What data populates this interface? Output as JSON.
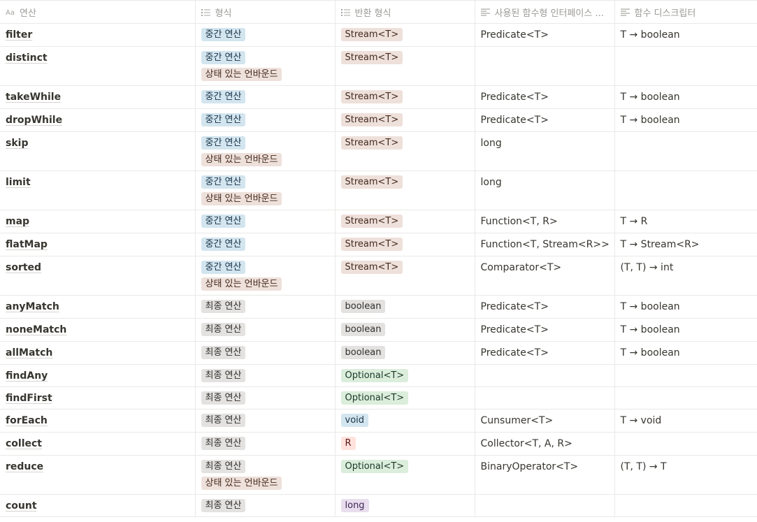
{
  "headers": [
    {
      "label": "연산",
      "icon": "title-aa-icon"
    },
    {
      "label": "형식",
      "icon": "multi-select-icon"
    },
    {
      "label": "반환 형식",
      "icon": "multi-select-icon"
    },
    {
      "label": "사용된 함수형 인터페이스 ...",
      "icon": "text-lines-icon"
    },
    {
      "label": "함수 디스크립터",
      "icon": "text-lines-icon"
    }
  ],
  "tag_colors": {
    "중간 연산": {
      "bg": "#d3e5ef",
      "fg": "#183347"
    },
    "최종 연산": {
      "bg": "#e3e2e0",
      "fg": "#32302c"
    },
    "상태 있는 언바운드": {
      "bg": "#eee0da",
      "fg": "#442a1e"
    },
    "Stream<T>": {
      "bg": "#eee0da",
      "fg": "#442a1e"
    },
    "boolean": {
      "bg": "#e3e2e0",
      "fg": "#32302c"
    },
    "Optional<T>": {
      "bg": "#dbeddb",
      "fg": "#1c3829"
    },
    "void": {
      "bg": "#d3e5ef",
      "fg": "#183347"
    },
    "R": {
      "bg": "#ffe2dd",
      "fg": "#5d1715"
    },
    "long": {
      "bg": "#e8deee",
      "fg": "#412454"
    }
  },
  "rows": [
    {
      "op": "filter",
      "types": [
        "중간 연산"
      ],
      "ret": "Stream<T>",
      "iface": "Predicate<T>",
      "desc": "T → boolean"
    },
    {
      "op": "distinct",
      "types": [
        "중간 연산",
        "상태 있는 언바운드"
      ],
      "ret": "Stream<T>",
      "iface": "",
      "desc": ""
    },
    {
      "op": "takeWhile",
      "types": [
        "중간 연산"
      ],
      "ret": "Stream<T>",
      "iface": "Predicate<T>",
      "desc": "T → boolean"
    },
    {
      "op": "dropWhile",
      "types": [
        "중간 연산"
      ],
      "ret": "Stream<T>",
      "iface": "Predicate<T>",
      "desc": "T → boolean"
    },
    {
      "op": "skip",
      "types": [
        "중간 연산",
        "상태 있는 언바운드"
      ],
      "ret": "Stream<T>",
      "iface": "long",
      "desc": ""
    },
    {
      "op": "limit",
      "types": [
        "중간 연산",
        "상태 있는 언바운드"
      ],
      "ret": "Stream<T>",
      "iface": "long",
      "desc": ""
    },
    {
      "op": "map",
      "types": [
        "중간 연산"
      ],
      "ret": "Stream<T>",
      "iface": "Function<T, R>",
      "desc": "T → R"
    },
    {
      "op": "flatMap",
      "types": [
        "중간 연산"
      ],
      "ret": "Stream<T>",
      "iface": "Function<T, Stream<R>>",
      "desc": "T → Stream<R>"
    },
    {
      "op": "sorted",
      "types": [
        "중간 연산",
        "상태 있는 언바운드"
      ],
      "ret": "Stream<T>",
      "iface": "Comparator<T>",
      "desc": "(T, T) → int"
    },
    {
      "op": "anyMatch",
      "types": [
        "최종 연산"
      ],
      "ret": "boolean",
      "iface": "Predicate<T>",
      "desc": "T → boolean"
    },
    {
      "op": "noneMatch",
      "types": [
        "최종 연산"
      ],
      "ret": "boolean",
      "iface": "Predicate<T>",
      "desc": "T → boolean"
    },
    {
      "op": "allMatch",
      "types": [
        "최종 연산"
      ],
      "ret": "boolean",
      "iface": "Predicate<T>",
      "desc": "T → boolean"
    },
    {
      "op": "findAny",
      "types": [
        "최종 연산"
      ],
      "ret": "Optional<T>",
      "iface": "",
      "desc": ""
    },
    {
      "op": "findFirst",
      "types": [
        "최종 연산"
      ],
      "ret": "Optional<T>",
      "iface": "",
      "desc": ""
    },
    {
      "op": "forEach",
      "types": [
        "최종 연산"
      ],
      "ret": "void",
      "iface": "Cunsumer<T>",
      "desc": "T → void"
    },
    {
      "op": "collect",
      "types": [
        "최종 연산"
      ],
      "ret": "R",
      "iface": "Collector<T, A, R>",
      "desc": ""
    },
    {
      "op": "reduce",
      "types": [
        "최종 연산",
        "상태 있는 언바운드"
      ],
      "ret": "Optional<T>",
      "iface": "BinaryOperator<T>",
      "desc": "(T, T) → T"
    },
    {
      "op": "count",
      "types": [
        "최종 연산"
      ],
      "ret": "long",
      "iface": "",
      "desc": ""
    }
  ]
}
